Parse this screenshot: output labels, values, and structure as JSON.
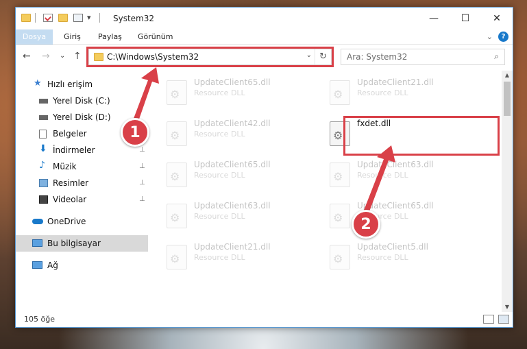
{
  "title": {
    "text": "System32"
  },
  "window_controls": {
    "minimize": "—",
    "maximize": "☐",
    "close": "✕"
  },
  "ribbon": {
    "tabs": [
      "Dosya",
      "Giriş",
      "Paylaş",
      "Görünüm"
    ],
    "expand": "⌄",
    "help": "?"
  },
  "nav": {
    "back": "←",
    "forward": "→",
    "recent": "⌄",
    "up": "↑",
    "address_path": "C:\\Windows\\System32",
    "address_dropdown": "⌄",
    "refresh": "↻",
    "search_placeholder": "Ara: System32",
    "search_icon": "⌕"
  },
  "sidebar": {
    "items": [
      {
        "label": "Hızlı erişim",
        "icon": "star-icon",
        "pinned": false
      },
      {
        "label": "Yerel Disk (C:)",
        "icon": "drive-icon",
        "pinned": false
      },
      {
        "label": "Yerel Disk (D:)",
        "icon": "drive-icon",
        "pinned": false
      },
      {
        "label": "Belgeler",
        "icon": "documents-icon",
        "pinned": true
      },
      {
        "label": "İndirmeler",
        "icon": "download-icon",
        "pinned": true
      },
      {
        "label": "Müzik",
        "icon": "music-icon",
        "pinned": true
      },
      {
        "label": "Resimler",
        "icon": "pictures-icon",
        "pinned": true
      },
      {
        "label": "Videolar",
        "icon": "videos-icon",
        "pinned": true
      },
      {
        "label": "OneDrive",
        "icon": "cloud-icon",
        "pinned": false
      },
      {
        "label": "Bu bilgisayar",
        "icon": "computer-icon",
        "pinned": false
      },
      {
        "label": "Ağ",
        "icon": "network-icon",
        "pinned": false
      }
    ],
    "pin_glyph": "📌"
  },
  "files": [
    {
      "name": "UpdateClient65.dll",
      "type": "Resource DLL"
    },
    {
      "name": "UpdateClient21.dll",
      "type": "Resource DLL"
    },
    {
      "name": "UpdateClient42.dll",
      "type": "Resource DLL"
    },
    {
      "name": "fxdet.dll",
      "type": ""
    },
    {
      "name": "UpdateClient65.dll",
      "type": "Resource DLL"
    },
    {
      "name": "UpdateClient63.dll",
      "type": "Resource DLL"
    },
    {
      "name": "UpdateClient63.dll",
      "type": "Resource DLL"
    },
    {
      "name": "UpdateClient65.dll",
      "type": "Resource DLL"
    },
    {
      "name": "UpdateClient21.dll",
      "type": "Resource DLL"
    },
    {
      "name": "UpdateClient5.dll",
      "type": "Resource DLL"
    }
  ],
  "status": {
    "count": "105 öğe"
  },
  "callouts": {
    "one": "1",
    "two": "2"
  },
  "colors": {
    "accent": "#1979ca",
    "highlight": "#d94048",
    "selected": "#d9d9d9"
  }
}
